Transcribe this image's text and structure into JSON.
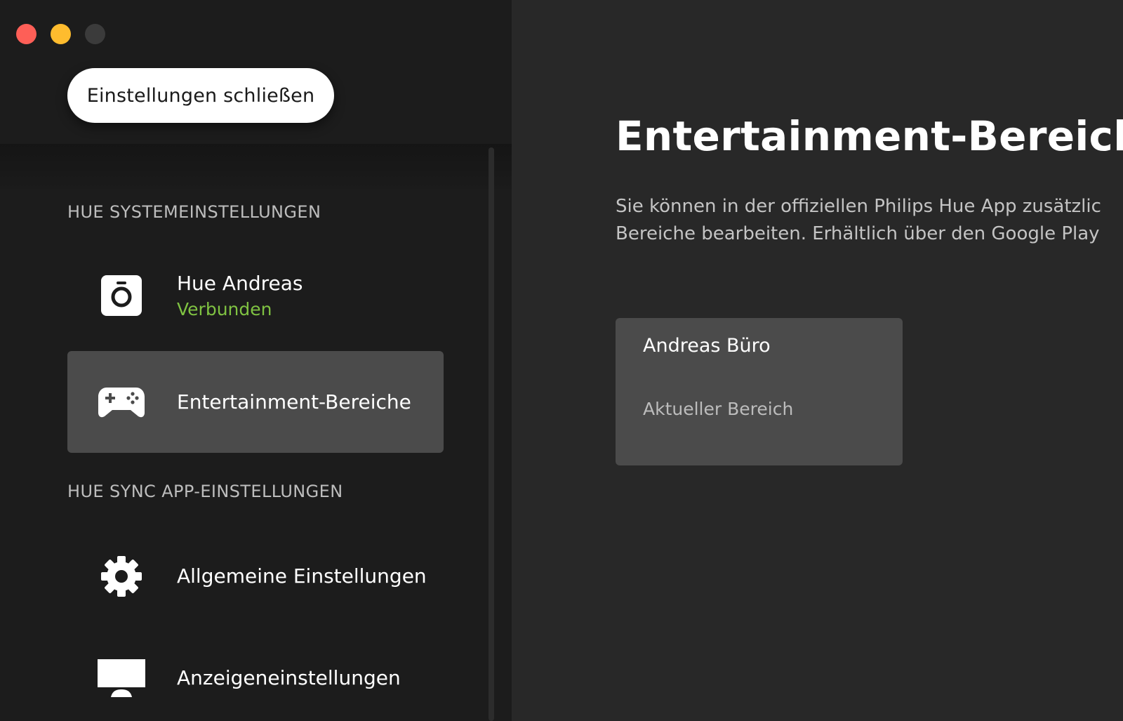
{
  "window": {
    "controls": [
      "close",
      "minimize",
      "maximize"
    ]
  },
  "sidebar": {
    "close_button_label": "Einstellungen schließen",
    "sections": [
      {
        "title": "HUE SYSTEMEINSTELLUNGEN",
        "items": [
          {
            "label": "Hue Andreas",
            "status": "Verbunden",
            "icon": "bridge-icon",
            "active": false
          },
          {
            "label": "Entertainment-Bereiche",
            "icon": "gamepad-icon",
            "active": true
          }
        ]
      },
      {
        "title": "HUE SYNC APP-EINSTELLUNGEN",
        "items": [
          {
            "label": "Allgemeine Einstellungen",
            "icon": "gear-icon",
            "active": false
          },
          {
            "label": "Anzeigeneinstellungen",
            "icon": "monitor-icon",
            "active": false
          }
        ]
      }
    ]
  },
  "main": {
    "title": "Entertainment-Bereiche",
    "description_line1": "Sie können in der offiziellen Philips Hue App zusätzlic",
    "description_line2": "Bereiche bearbeiten. Erhältlich über den Google Play",
    "areas": [
      {
        "name": "Andreas Büro",
        "status": "Aktueller Bereich"
      }
    ]
  },
  "colors": {
    "sidebar_bg": "#1c1c1c",
    "main_bg": "#282828",
    "active_item_bg": "#4b4b4b",
    "connected_status": "#7fc242",
    "close_dot": "#fe5f57",
    "minimize_dot": "#febc2e",
    "maximize_dot": "#3b3b3b"
  }
}
